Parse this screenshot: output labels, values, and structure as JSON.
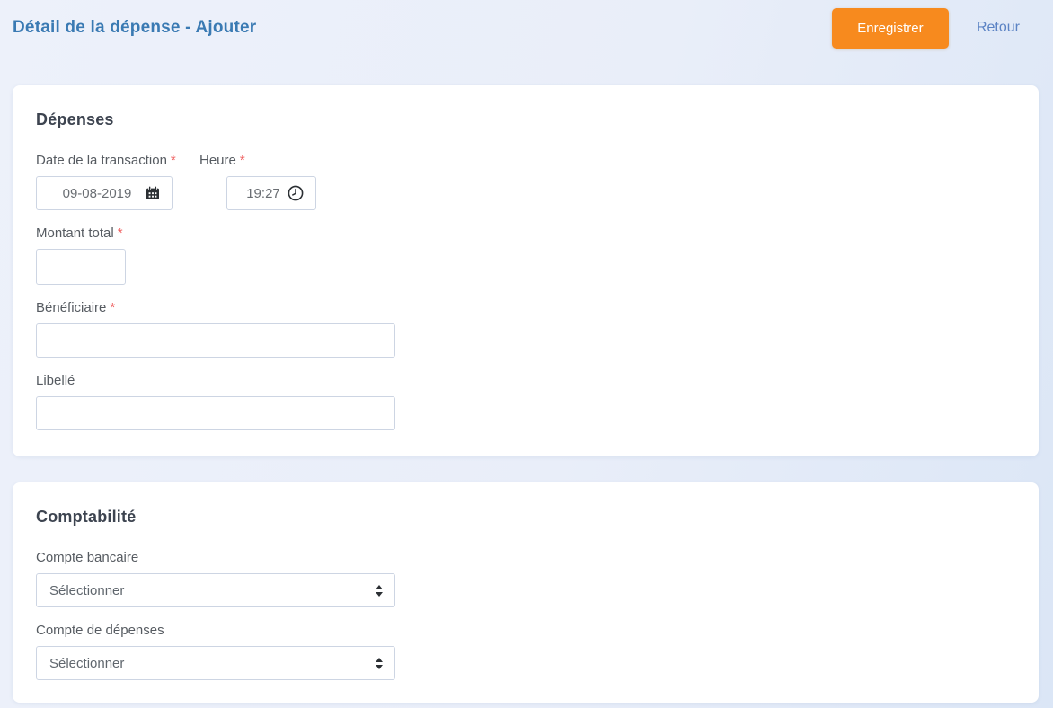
{
  "page": {
    "title": "Détail de la dépense - Ajouter"
  },
  "actions": {
    "save_label": "Enregistrer",
    "back_label": "Retour"
  },
  "required_marker": "*",
  "cards": {
    "expenses": {
      "title": "Dépenses",
      "date": {
        "label": "Date de la transaction",
        "required": true,
        "value": "09-08-2019"
      },
      "time": {
        "label": "Heure",
        "required": true,
        "value": "19:27"
      },
      "amount": {
        "label": "Montant total",
        "required": true,
        "value": ""
      },
      "beneficiary": {
        "label": "Bénéficiaire",
        "required": true,
        "value": ""
      },
      "description": {
        "label": "Libellé",
        "required": false,
        "value": ""
      }
    },
    "accounting": {
      "title": "Comptabilité",
      "bank_account": {
        "label": "Compte bancaire",
        "selected": "Sélectionner"
      },
      "expense_account": {
        "label": "Compte de dépenses",
        "selected": "Sélectionner"
      }
    }
  },
  "icons": {
    "date": "calendar-icon",
    "time": "clock-icon",
    "select": "updown-caret-icon"
  },
  "colors": {
    "accent_orange": "#f78a1e",
    "title_blue": "#3a7ab3",
    "link_blue": "#5b83c4",
    "required_red": "#ef5f5f",
    "card_heading": "#3d4450",
    "input_border": "#cdd5e3",
    "page_background": "#e9eef9"
  }
}
